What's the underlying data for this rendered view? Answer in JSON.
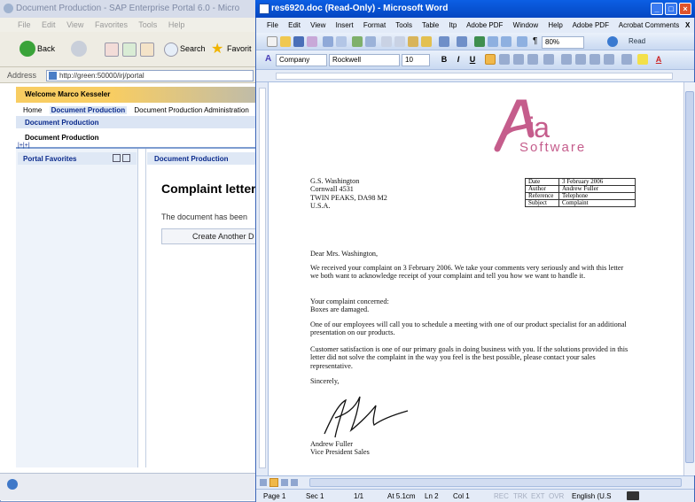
{
  "ie": {
    "title": "Document Production - SAP Enterprise Portal 6.0 - Micro",
    "menu": [
      "File",
      "Edit",
      "View",
      "Favorites",
      "Tools",
      "Help"
    ],
    "back_label": "Back",
    "search_label": "Search",
    "favorites_label": "Favorit",
    "address_label": "Address",
    "address_value": "http://green:50000/irj/portal"
  },
  "portal": {
    "welcome": "Welcome Marco Kesseler",
    "nav": [
      "Home",
      "Document Production",
      "Document Production Administration"
    ],
    "subnav": "Document Production",
    "page_heading": "Document Production",
    "expand_toggle": "|+|+|",
    "favorites_title": "Portal Favorites",
    "doc_panel_title": "Document Production",
    "complaint_title": "Complaint letter",
    "message": "The document has been",
    "create_button": "Create Another D"
  },
  "word": {
    "title": "res6920.doc (Read-Only) - Microsoft Word",
    "menu": [
      "File",
      "Edit",
      "View",
      "Insert",
      "Format",
      "Tools",
      "Table",
      "Itp",
      "Adobe PDF",
      "Window",
      "Help",
      "Adobe PDF",
      "Acrobat Comments"
    ],
    "close_x": "X",
    "zoom": "80%",
    "read_label": "Read",
    "style": "Company",
    "font": "Rockwell",
    "size": "10",
    "status": {
      "page": "Page 1",
      "sec": "Sec 1",
      "pages": "1/1",
      "at": "At 5.1cm",
      "ln": "Ln 2",
      "col": "Col 1",
      "modes": [
        "REC",
        "TRK",
        "EXT",
        "OVR"
      ],
      "language": "English (U.S"
    }
  },
  "letter": {
    "logo_ia": "ia",
    "logo_software": "Software",
    "address": [
      "G.S. Washington",
      "Cornwall 4531",
      "TWIN PEAKS, DA98 M2",
      "U.S.A."
    ],
    "info": [
      {
        "k": "Date",
        "v": "3 February 2006"
      },
      {
        "k": "Author",
        "v": "Andrew Fuller"
      },
      {
        "k": "Reference",
        "v": "Telephone"
      },
      {
        "k": "Subject",
        "v": "Complaint"
      }
    ],
    "greeting": "Dear Mrs. Washington,",
    "p1": "We received your complaint on 3 February 2006. We take your comments very seriously and with this letter we both want to acknowledge receipt of your complaint and tell you how we want to handle it.",
    "p2a": "Your complaint concerned:",
    "p2b": "Boxes are damaged.",
    "p3": "One of our employees will call you to schedule a meeting with one of our product specialist for an additional presentation on our products.",
    "p4": "Customer satisfaction is one of our primary goals in doing business with you. If the solutions provided in this letter did not solve the complaint in the way you feel is the best possible, please contact your sales representative.",
    "closing": "Sincerely,",
    "signer": "Andrew Fuller",
    "signer_title": "Vice President Sales"
  }
}
